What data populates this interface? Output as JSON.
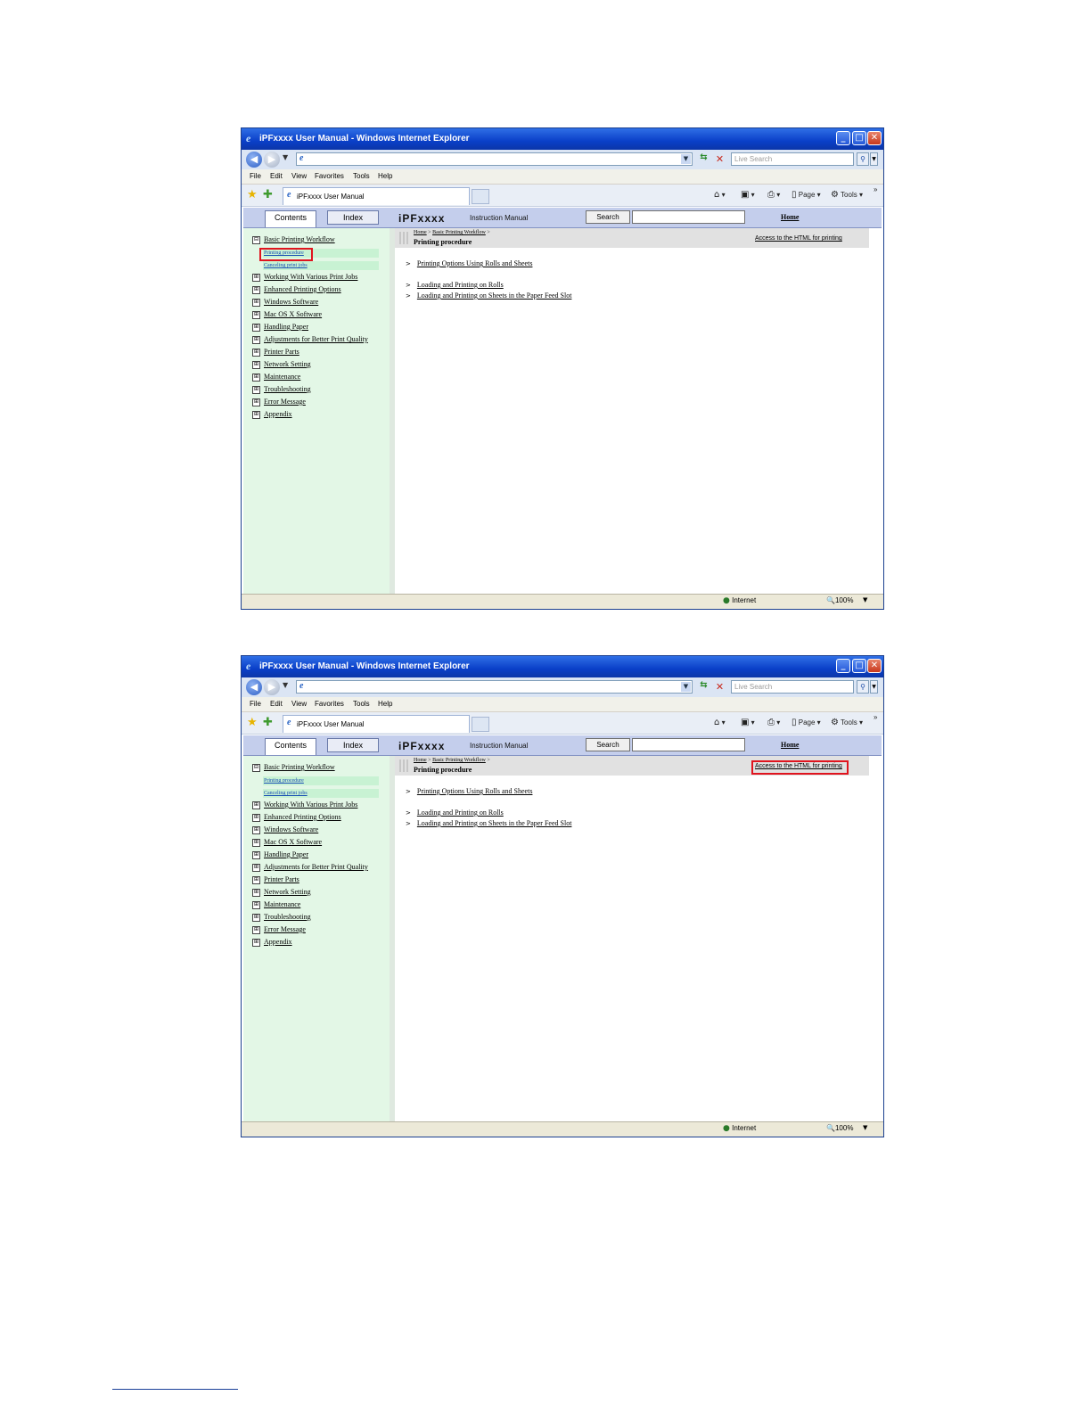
{
  "browser": {
    "title": "iPFxxxx User Manual - Windows Internet Explorer",
    "search_placeholder": "Live Search",
    "menu": [
      "File",
      "Edit",
      "View",
      "Favorites",
      "Tools",
      "Help"
    ],
    "tab_label": "iPFxxxx User Manual",
    "page_cmd": "Page",
    "tools_cmd": "Tools",
    "status_zone": "Internet",
    "zoom": "100%"
  },
  "manual": {
    "tab_contents": "Contents",
    "tab_index": "Index",
    "brand": "iPFxxxx",
    "brand_sub": "Instruction Manual",
    "search_button": "Search",
    "home_link": "Home"
  },
  "sidebar": {
    "first": "Basic Printing Workflow",
    "subitems": [
      "Printing procedure",
      "Canceling print jobs"
    ],
    "items": [
      "Working With Various Print Jobs",
      "Enhanced Printing Options",
      "Windows Software",
      "Mac OS X Software",
      "Handling Paper",
      "Adjustments for Better Print Quality",
      "Printer Parts",
      "Network Setting",
      "Maintenance",
      "Troubleshooting",
      "Error Message",
      "Appendix"
    ]
  },
  "content": {
    "breadcrumb_home": "Home",
    "breadcrumb_section": "Basic Printing Workflow",
    "breadcrumb_sep": ">",
    "title": "Printing procedure",
    "print_link": "Access to the HTML for printing",
    "links": [
      "Printing Options Using Rolls and Sheets",
      "Loading and Printing on Rolls",
      "Loading and Printing on Sheets in the Paper Feed Slot"
    ]
  },
  "colors": {
    "highlight": "#e0141e",
    "sidebar_bg": "#e3f7e6",
    "header_bg": "#c4ceec"
  }
}
